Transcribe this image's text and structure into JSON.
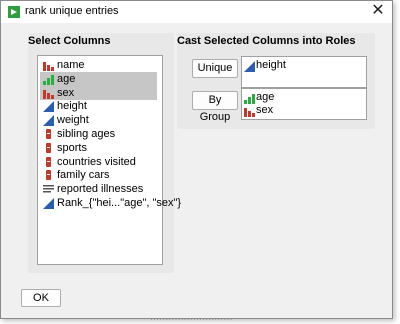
{
  "window": {
    "title": "rank unique entries",
    "close_glyph": "✕",
    "icon": "app-icon"
  },
  "select_columns": {
    "title": "Select Columns",
    "items": [
      {
        "label": "name",
        "icon": "nominal-bar-icon",
        "selected": false
      },
      {
        "label": "age",
        "icon": "ordinal-bar-icon",
        "selected": true
      },
      {
        "label": "sex",
        "icon": "nominal-bar-icon",
        "selected": true
      },
      {
        "label": "height",
        "icon": "continuous-ramp-icon",
        "selected": false
      },
      {
        "label": "weight",
        "icon": "continuous-ramp-icon",
        "selected": false
      },
      {
        "label": "sibling ages",
        "icon": "expression-icon",
        "selected": false
      },
      {
        "label": "sports",
        "icon": "expression-icon",
        "selected": false
      },
      {
        "label": "countries visited",
        "icon": "expression-icon",
        "selected": false
      },
      {
        "label": "family cars",
        "icon": "expression-icon",
        "selected": false
      },
      {
        "label": "reported illnesses",
        "icon": "text-lines-icon",
        "selected": false
      },
      {
        "label": "Rank_{\"hei...\"age\", \"sex\"}",
        "icon": "continuous-ramp-icon",
        "selected": false
      }
    ]
  },
  "roles": {
    "title": "Cast Selected Columns into Roles",
    "unique": {
      "button_label": "Unique",
      "items": [
        {
          "label": "height",
          "icon": "continuous-ramp-icon"
        }
      ]
    },
    "by_group": {
      "button_label": "By Group",
      "items": [
        {
          "label": "age",
          "icon": "ordinal-bar-icon"
        },
        {
          "label": "sex",
          "icon": "nominal-bar-icon"
        }
      ]
    }
  },
  "ok_label": "OK",
  "background_text": "...........................",
  "colors": {
    "nominal": "#c0392b",
    "ordinal": "#27ae3c",
    "continuous": "#2a5db0",
    "selection": "#c6c6c6"
  }
}
